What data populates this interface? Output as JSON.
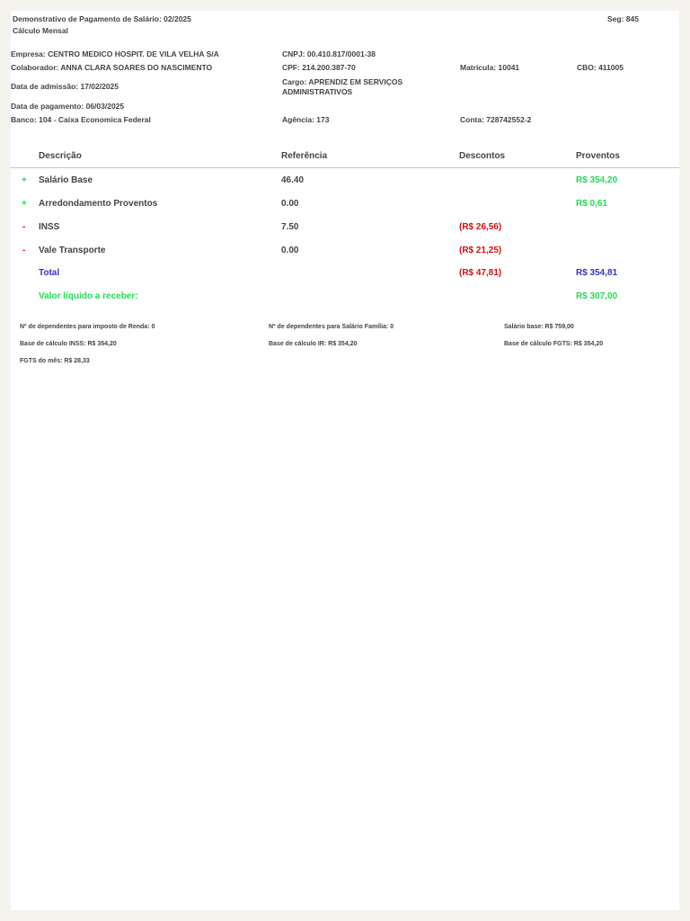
{
  "header": {
    "title": "Demonstrativo de Pagamento de Salário: 02/2025",
    "subtitle": "Cálculo Mensal",
    "seg": "Seg: 845"
  },
  "info": {
    "empresa": "Empresa: CENTRO MEDICO HOSPIT. DE VILA VELHA S/A",
    "cnpj": "CNPJ: 00.410.817/0001-38",
    "colaborador": "Colaborador: ANNA CLARA SOARES DO NASCIMENTO",
    "cpf": "CPF: 214.200.387-70",
    "matricula": "Matrícula: 10041",
    "cbo": "CBO: 411005",
    "admissao": "Data de admissão: 17/02/2025",
    "cargo": "Cargo: APRENDIZ EM SERVIÇOS ADMINISTRATIVOS",
    "pagamento": "Data de pagamento: 06/03/2025",
    "banco": "Banco: 104 - Caixa Economica Federal",
    "agencia": "Agência: 173",
    "conta": "Conta: 728742552-2"
  },
  "table": {
    "headers": {
      "descricao": "Descrição",
      "referencia": "Referência",
      "descontos": "Descontos",
      "proventos": "Proventos"
    },
    "rows": [
      {
        "sign": "+",
        "descricao": "Salário Base",
        "referencia": "46.40",
        "descontos": "",
        "proventos": "R$ 354,20"
      },
      {
        "sign": "+",
        "descricao": "Arredondamento Proventos",
        "referencia": "0.00",
        "descontos": "",
        "proventos": "R$ 0,61"
      },
      {
        "sign": "-",
        "descricao": "INSS",
        "referencia": "7.50",
        "descontos": "(R$ 26,56)",
        "proventos": ""
      },
      {
        "sign": "-",
        "descricao": "Vale Transporte",
        "referencia": "0.00",
        "descontos": "(R$ 21,25)",
        "proventos": ""
      }
    ],
    "total": {
      "label": "Total",
      "descontos": "(R$ 47,81)",
      "proventos": "R$ 354,81"
    },
    "liquido": {
      "label": "Valor líquido a receber:",
      "value": "R$ 307,00"
    }
  },
  "footer": {
    "dep_ir": "Nº de dependentes para imposto de Renda: 0",
    "dep_familia": "Nº de dependentes para Salário Família: 0",
    "salario_base": "Salário base: R$ 759,00",
    "base_inss": "Base de cálculo INSS: R$ 354,20",
    "base_ir": "Base de cálculo IR: R$ 354,20",
    "base_fgts": "Base de cálculo FGTS: R$ 354,20",
    "fgts_mes": "FGTS do mês: R$ 28,33"
  },
  "colors": {
    "background": "#f4f3ee",
    "page": "#ffffff",
    "text": "#444444",
    "provento": "#22dd55",
    "desconto": "#d11111",
    "total": "#3333cc"
  }
}
